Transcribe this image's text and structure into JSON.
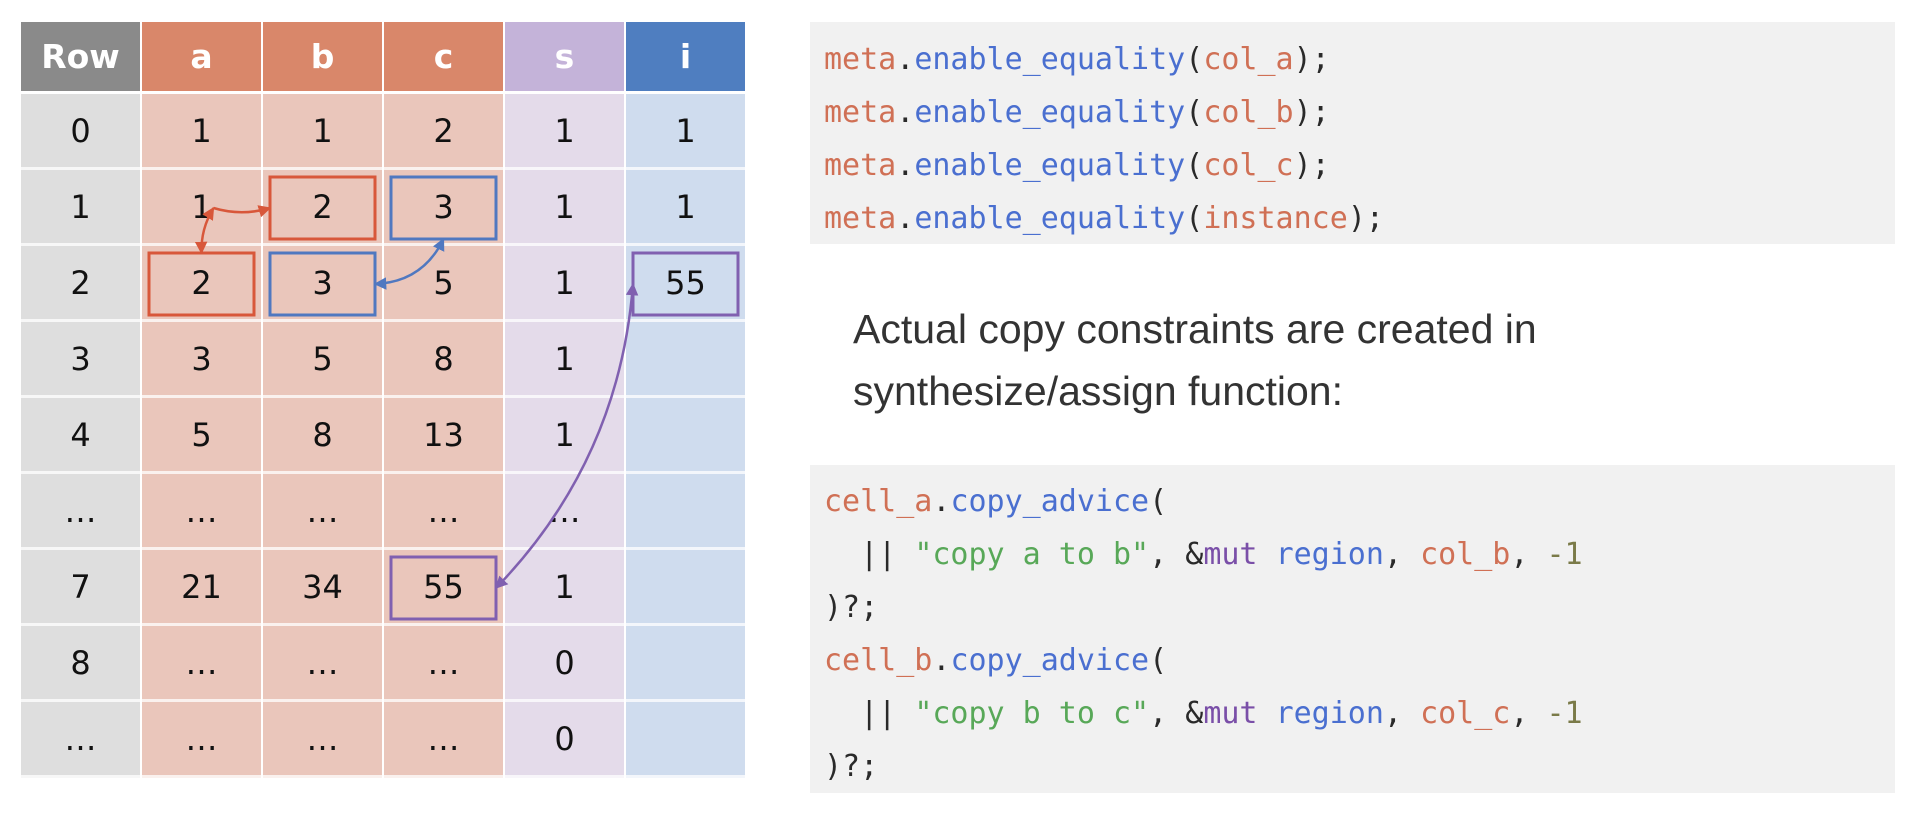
{
  "table": {
    "headers": [
      {
        "label": "Row",
        "kind": "row"
      },
      {
        "label": "a",
        "kind": "adv"
      },
      {
        "label": "b",
        "kind": "adv"
      },
      {
        "label": "c",
        "kind": "adv"
      },
      {
        "label": "s",
        "kind": "sel"
      },
      {
        "label": "i",
        "kind": "ins"
      }
    ],
    "rows": [
      [
        "0",
        "1",
        "1",
        "2",
        "1",
        "1"
      ],
      [
        "1",
        "1",
        "2",
        "3",
        "1",
        "1"
      ],
      [
        "2",
        "2",
        "3",
        "5",
        "1",
        "55"
      ],
      [
        "3",
        "3",
        "5",
        "8",
        "1",
        ""
      ],
      [
        "4",
        "5",
        "8",
        "13",
        "1",
        ""
      ],
      [
        "…",
        "…",
        "…",
        "…",
        "…",
        ""
      ],
      [
        "7",
        "21",
        "34",
        "55",
        "1",
        ""
      ],
      [
        "8",
        "…",
        "…",
        "…",
        "0",
        ""
      ],
      [
        "…",
        "…",
        "…",
        "…",
        "0",
        ""
      ]
    ],
    "highlight_colors": {
      "red": "#d8573a",
      "blue": "#5078c0",
      "purple": "#8060b0"
    },
    "highlights": [
      {
        "row": 1,
        "col": 2,
        "color": "red"
      },
      {
        "row": 2,
        "col": 1,
        "color": "red"
      },
      {
        "row": 1,
        "col": 3,
        "color": "blue"
      },
      {
        "row": 2,
        "col": 2,
        "color": "blue"
      },
      {
        "row": 2,
        "col": 5,
        "color": "purple"
      },
      {
        "row": 6,
        "col": 3,
        "color": "purple"
      }
    ],
    "links": [
      {
        "from": {
          "row": 1,
          "col": 1
        },
        "to": {
          "row": 2,
          "col": 1
        },
        "color": "red"
      },
      {
        "from": {
          "row": 1,
          "col": 1
        },
        "to": {
          "row": 1,
          "col": 2
        },
        "color": "red"
      },
      {
        "from": {
          "row": 2,
          "col": 2
        },
        "to": {
          "row": 1,
          "col": 3
        },
        "color": "blue"
      },
      {
        "from": {
          "row": 6,
          "col": 3
        },
        "to": {
          "row": 2,
          "col": 5
        },
        "color": "purple"
      }
    ]
  },
  "code_top": [
    [
      {
        "t": "meta",
        "k": "obj"
      },
      {
        "t": ".",
        "k": "plain"
      },
      {
        "t": "enable_equality",
        "k": "fn"
      },
      {
        "t": "(",
        "k": "plain"
      },
      {
        "t": "col_a",
        "k": "obj"
      },
      {
        "t": ");",
        "k": "plain"
      }
    ],
    [
      {
        "t": "meta",
        "k": "obj"
      },
      {
        "t": ".",
        "k": "plain"
      },
      {
        "t": "enable_equality",
        "k": "fn"
      },
      {
        "t": "(",
        "k": "plain"
      },
      {
        "t": "col_b",
        "k": "obj"
      },
      {
        "t": ");",
        "k": "plain"
      }
    ],
    [
      {
        "t": "meta",
        "k": "obj"
      },
      {
        "t": ".",
        "k": "plain"
      },
      {
        "t": "enable_equality",
        "k": "fn"
      },
      {
        "t": "(",
        "k": "plain"
      },
      {
        "t": "col_c",
        "k": "obj"
      },
      {
        "t": ");",
        "k": "plain"
      }
    ],
    [
      {
        "t": "meta",
        "k": "obj"
      },
      {
        "t": ".",
        "k": "plain"
      },
      {
        "t": "enable_equality",
        "k": "fn"
      },
      {
        "t": "(",
        "k": "plain"
      },
      {
        "t": "instance",
        "k": "obj"
      },
      {
        "t": ");",
        "k": "plain"
      }
    ]
  ],
  "caption": "Actual copy constraints are created in synthesize/assign function:",
  "code_bottom": [
    [
      {
        "t": "cell_a",
        "k": "obj"
      },
      {
        "t": ".",
        "k": "plain"
      },
      {
        "t": "copy_advice",
        "k": "fn"
      },
      {
        "t": "(",
        "k": "plain"
      }
    ],
    [
      {
        "t": "  || ",
        "k": "plain"
      },
      {
        "t": "\"copy a to b\"",
        "k": "str"
      },
      {
        "t": ", &",
        "k": "plain"
      },
      {
        "t": "mut",
        "k": "kw"
      },
      {
        "t": " ",
        "k": "plain"
      },
      {
        "t": "region",
        "k": "fn"
      },
      {
        "t": ", ",
        "k": "plain"
      },
      {
        "t": "col_b",
        "k": "obj"
      },
      {
        "t": ", ",
        "k": "plain"
      },
      {
        "t": "-1",
        "k": "num"
      }
    ],
    [
      {
        "t": ")?;",
        "k": "plain"
      }
    ],
    [
      {
        "t": "cell_b",
        "k": "obj"
      },
      {
        "t": ".",
        "k": "plain"
      },
      {
        "t": "copy_advice",
        "k": "fn"
      },
      {
        "t": "(",
        "k": "plain"
      }
    ],
    [
      {
        "t": "  || ",
        "k": "plain"
      },
      {
        "t": "\"copy b to c\"",
        "k": "str"
      },
      {
        "t": ", &",
        "k": "plain"
      },
      {
        "t": "mut",
        "k": "kw"
      },
      {
        "t": " ",
        "k": "plain"
      },
      {
        "t": "region",
        "k": "fn"
      },
      {
        "t": ", ",
        "k": "plain"
      },
      {
        "t": "col_c",
        "k": "obj"
      },
      {
        "t": ", ",
        "k": "plain"
      },
      {
        "t": "-1",
        "k": "num"
      }
    ],
    [
      {
        "t": ")?;",
        "k": "plain"
      }
    ]
  ]
}
